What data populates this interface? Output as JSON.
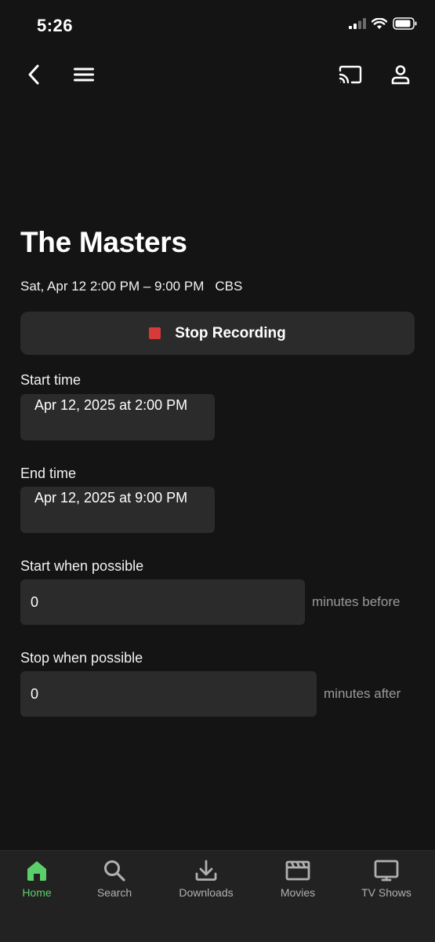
{
  "status_bar": {
    "time": "5:26"
  },
  "nav": {
    "back_icon": "chevron-left-icon",
    "menu_icon": "hamburger-icon",
    "cast_icon": "cast-icon",
    "profile_icon": "person-icon"
  },
  "show": {
    "title": "The Masters",
    "schedule": "Sat, Apr 12 2:00 PM – 9:00 PM",
    "channel": "CBS"
  },
  "stop_recording": {
    "label": "Stop Recording",
    "indicator_color": "#d83a3a"
  },
  "start_time": {
    "label": "Start time",
    "value": "Apr 12, 2025 at 2:00 PM"
  },
  "end_time": {
    "label": "End time",
    "value": "Apr 12, 2025 at 9:00 PM"
  },
  "start_padding": {
    "label": "Start when possible",
    "value": "0",
    "unit": "minutes before"
  },
  "stop_padding": {
    "label": "Stop when possible",
    "value": "0",
    "unit": "minutes after"
  },
  "tabs": [
    {
      "label": "Home",
      "icon": "home-icon",
      "active": true
    },
    {
      "label": "Search",
      "icon": "search-icon",
      "active": false
    },
    {
      "label": "Downloads",
      "icon": "download-icon",
      "active": false
    },
    {
      "label": "Movies",
      "icon": "clapperboard-icon",
      "active": false
    },
    {
      "label": "TV Shows",
      "icon": "tv-icon",
      "active": false
    }
  ],
  "colors": {
    "accent": "#5bd06a",
    "background": "#141414",
    "surface": "#2b2b2b",
    "record_red": "#d83a3a"
  }
}
